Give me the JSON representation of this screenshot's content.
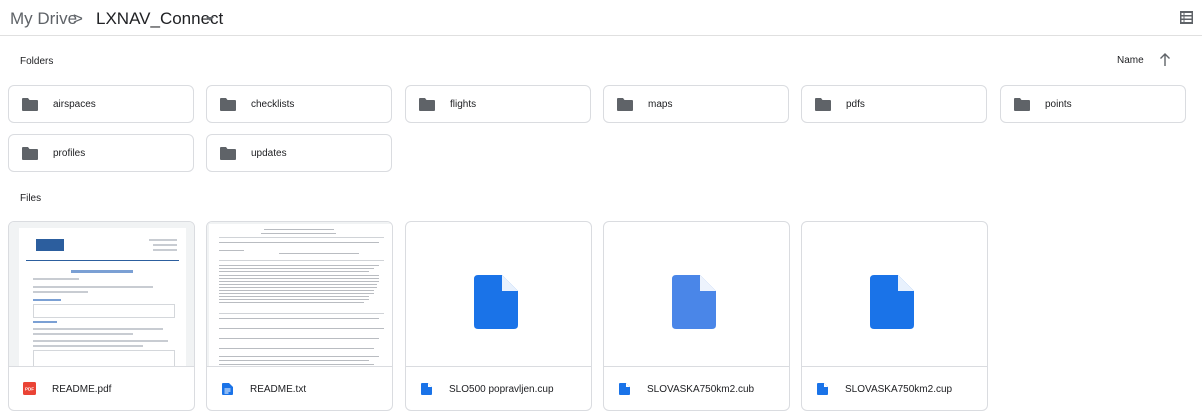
{
  "breadcrumb": {
    "root": "My Drive",
    "separator": ">",
    "current": "LXNAV_Connect"
  },
  "sections": {
    "folders_label": "Folders",
    "files_label": "Files",
    "sort_label": "Name"
  },
  "folders": [
    {
      "name": "airspaces"
    },
    {
      "name": "checklists"
    },
    {
      "name": "flights"
    },
    {
      "name": "maps"
    },
    {
      "name": "pdfs"
    },
    {
      "name": "points"
    },
    {
      "name": "profiles"
    },
    {
      "name": "updates"
    }
  ],
  "files": [
    {
      "name": "README.pdf",
      "type": "pdf",
      "icon": "pdf-icon",
      "icon_label": "PDF"
    },
    {
      "name": "README.txt",
      "type": "txt",
      "icon": "doc-icon"
    },
    {
      "name": "SLO500 popravljen.cup",
      "type": "generic",
      "icon": "file-icon"
    },
    {
      "name": "SLOVASKA750km2.cub",
      "type": "generic",
      "icon": "file-icon"
    },
    {
      "name": "SLOVASKA750km2.cup",
      "type": "generic",
      "icon": "file-icon"
    }
  ],
  "colors": {
    "folder_icon": "#5f6368",
    "file_blue": "#1a73e8",
    "pdf_red": "#ea4335"
  }
}
